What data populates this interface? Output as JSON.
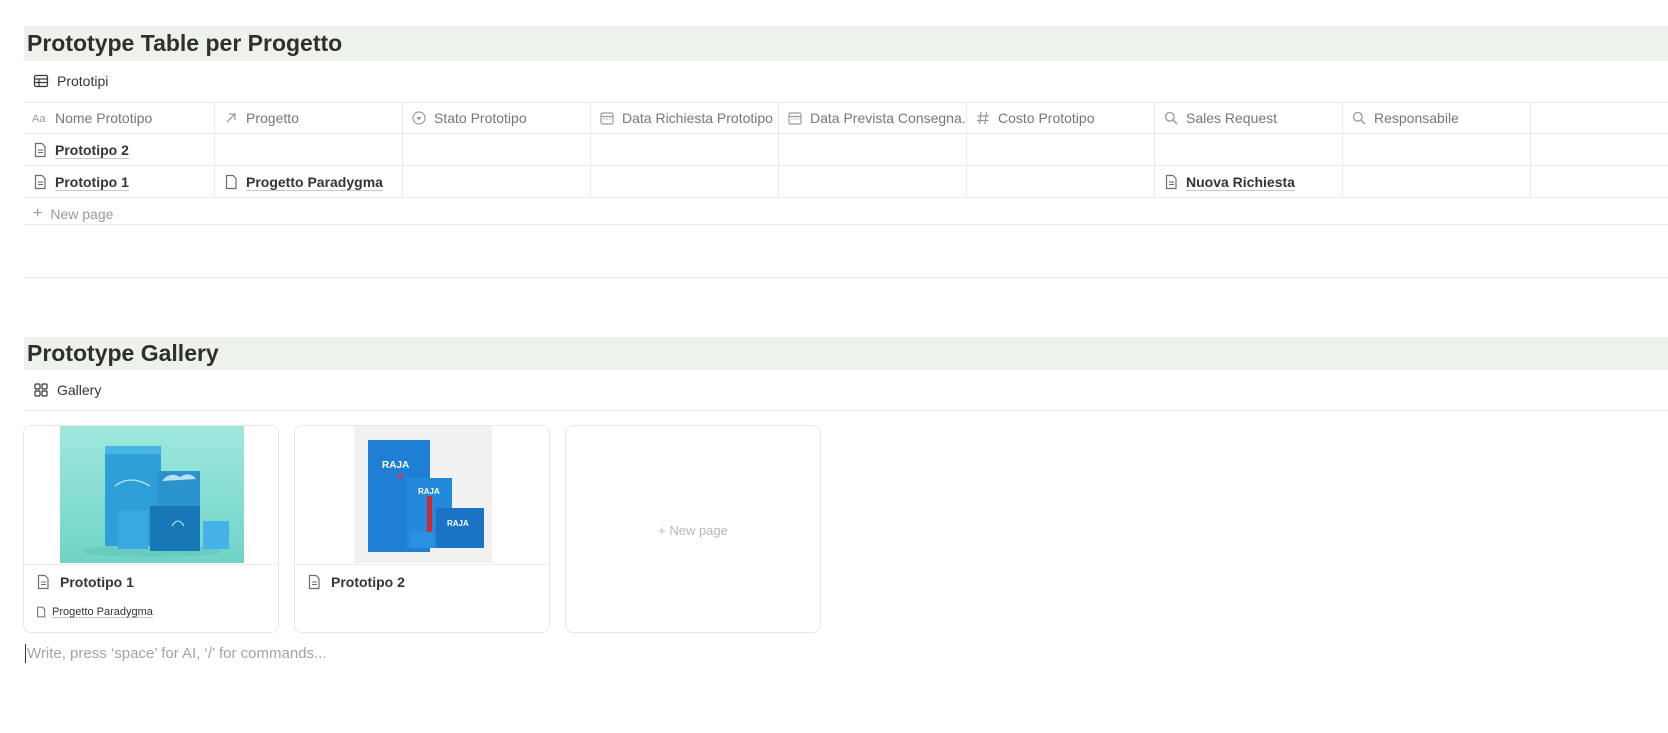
{
  "table_section": {
    "heading": "Prototype Table per Progetto",
    "view_name": "Prototipi",
    "columns": [
      {
        "label": "Nome Prototipo",
        "icon": "text-aa-icon"
      },
      {
        "label": "Progetto",
        "icon": "relation-arrow-icon"
      },
      {
        "label": "Stato Prototipo",
        "icon": "status-icon"
      },
      {
        "label": "Data Richiesta Prototipo",
        "icon": "calendar-icon"
      },
      {
        "label": "Data Prevista Consegna...",
        "icon": "calendar-icon"
      },
      {
        "label": "Costo Prototipo",
        "icon": "number-hash-icon"
      },
      {
        "label": "Sales Request",
        "icon": "search-lookup-icon"
      },
      {
        "label": "Responsabile",
        "icon": "search-lookup-icon"
      }
    ],
    "rows": [
      {
        "name": "Prototipo 2",
        "progetto": "",
        "sales_request": ""
      },
      {
        "name": "Prototipo 1",
        "progetto": "Progetto Paradygma",
        "sales_request": "Nuova Richiesta"
      }
    ],
    "new_page_label": "New page"
  },
  "gallery_section": {
    "heading": "Prototype Gallery",
    "view_name": "Gallery",
    "cards": [
      {
        "title": "Prototipo 1",
        "property": "Progetto Paradygma",
        "cover": "teal-packaging-photo"
      },
      {
        "title": "Prototipo 2",
        "property": "",
        "cover": "blue-raja-packaging-photo"
      }
    ],
    "cover_texts": {
      "brand": "RAJA"
    },
    "new_page_label": "New page"
  },
  "editor": {
    "placeholder": "Write, press ‘space’ for AI, ‘/’ for commands..."
  },
  "colors": {
    "heading_background": "#edf3ec",
    "text": "#37352f",
    "muted": "#787774",
    "teal_cover": "#8fe0d6",
    "raja_blue": "#1f7fd4"
  }
}
